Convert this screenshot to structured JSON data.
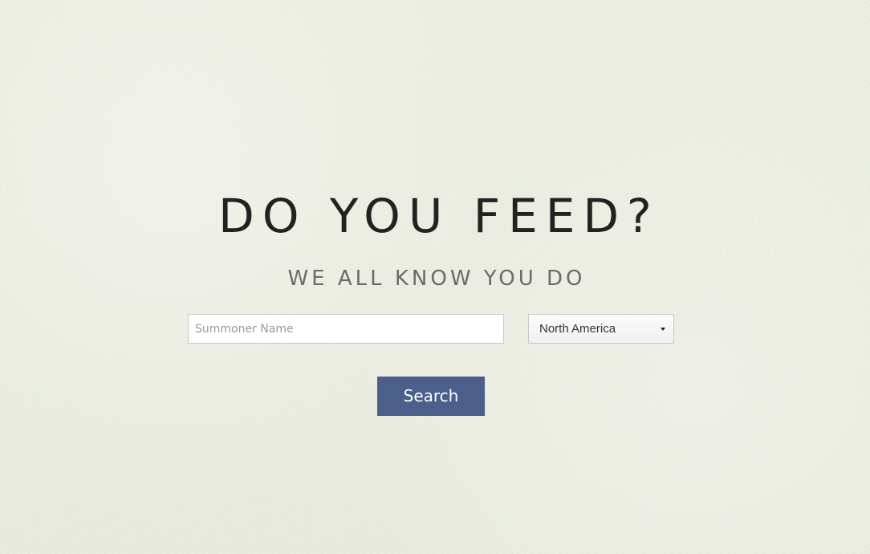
{
  "hero": {
    "title": "DO YOU FEED?",
    "subtitle": "WE ALL KNOW YOU DO"
  },
  "form": {
    "summoner_input": {
      "value": "",
      "placeholder": "Summoner Name"
    },
    "region_select": {
      "selected": "North America",
      "icon": "chevron-down-icon"
    },
    "search_button_label": "Search"
  },
  "colors": {
    "background": "#ebede0",
    "title": "#222222",
    "subtitle": "#6b6b6b",
    "button": "#4a5f8a",
    "button_text": "#ffffff"
  }
}
